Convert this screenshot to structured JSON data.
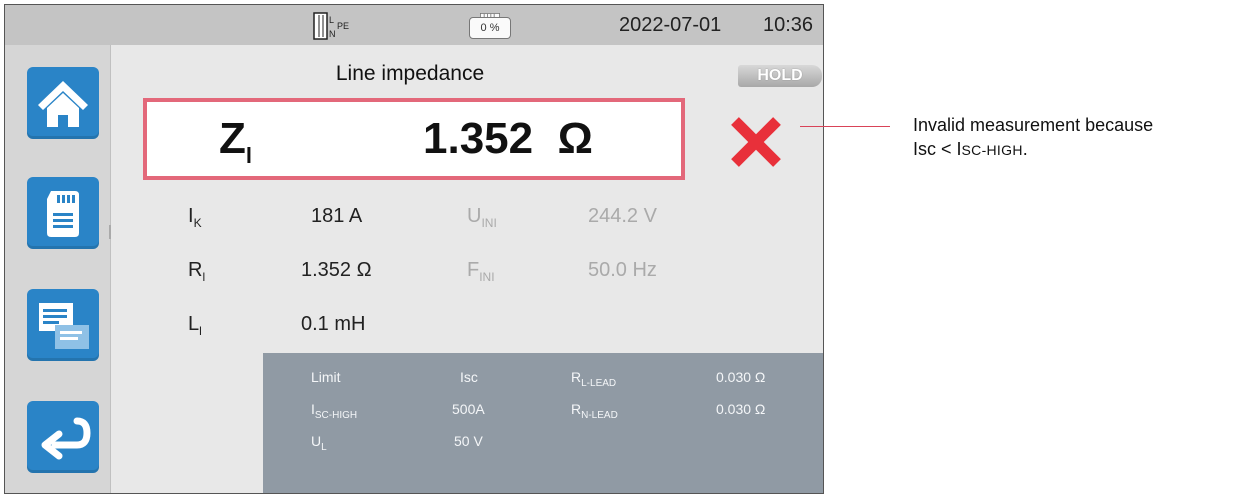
{
  "status_bar": {
    "circuit": {
      "l": "L",
      "n": "N",
      "pe": "PE"
    },
    "battery_level": "0 %",
    "date": "2022-07-01",
    "time": "10:36"
  },
  "sidebar": {
    "items": [
      {
        "icon": "home-icon"
      },
      {
        "icon": "sd-card-icon"
      },
      {
        "icon": "records-icon"
      },
      {
        "icon": "back-arrow-icon"
      }
    ]
  },
  "header": {
    "title": "Line impedance",
    "hold": "HOLD"
  },
  "main_measurement": {
    "symbol": "Z",
    "subscript": "l",
    "value": "1.352",
    "unit": "Ω"
  },
  "measurements": [
    {
      "symbol": "I",
      "subscript": "K",
      "value": "181 A"
    },
    {
      "symbol": "R",
      "subscript": "l",
      "value": "1.352 Ω"
    },
    {
      "symbol": "L",
      "subscript": "l",
      "value": "0.1 mH"
    }
  ],
  "secondary": [
    {
      "symbol": "U",
      "subscript": "INI",
      "value": "244.2 V"
    },
    {
      "symbol": "F",
      "subscript": "INI",
      "value": "50.0 Hz"
    }
  ],
  "params": {
    "limit_label": "Limit",
    "limit_value": "Isc",
    "isc_high_symbol": "I",
    "isc_high_subscript": "SC-HIGH",
    "isc_high_value": "500A",
    "ul_symbol": "U",
    "ul_subscript": "L",
    "ul_value": "50 V",
    "rl_lead_symbol": "R",
    "rl_lead_subscript": "L-LEAD",
    "rl_lead_value": "0.030 Ω",
    "rn_lead_symbol": "R",
    "rn_lead_subscript": "N-LEAD",
    "rn_lead_value": "0.030 Ω"
  },
  "callout": {
    "line1": "Invalid measurement because",
    "line2_prefix": "Isc < I",
    "line2_smallcaps": "SC-HIGH",
    "line2_suffix": "."
  },
  "colors": {
    "accent_blue": "#2a84c7",
    "frame_pink": "#e3687a",
    "invalid_red": "#e8303a",
    "panel_gray": "#909aa4"
  }
}
